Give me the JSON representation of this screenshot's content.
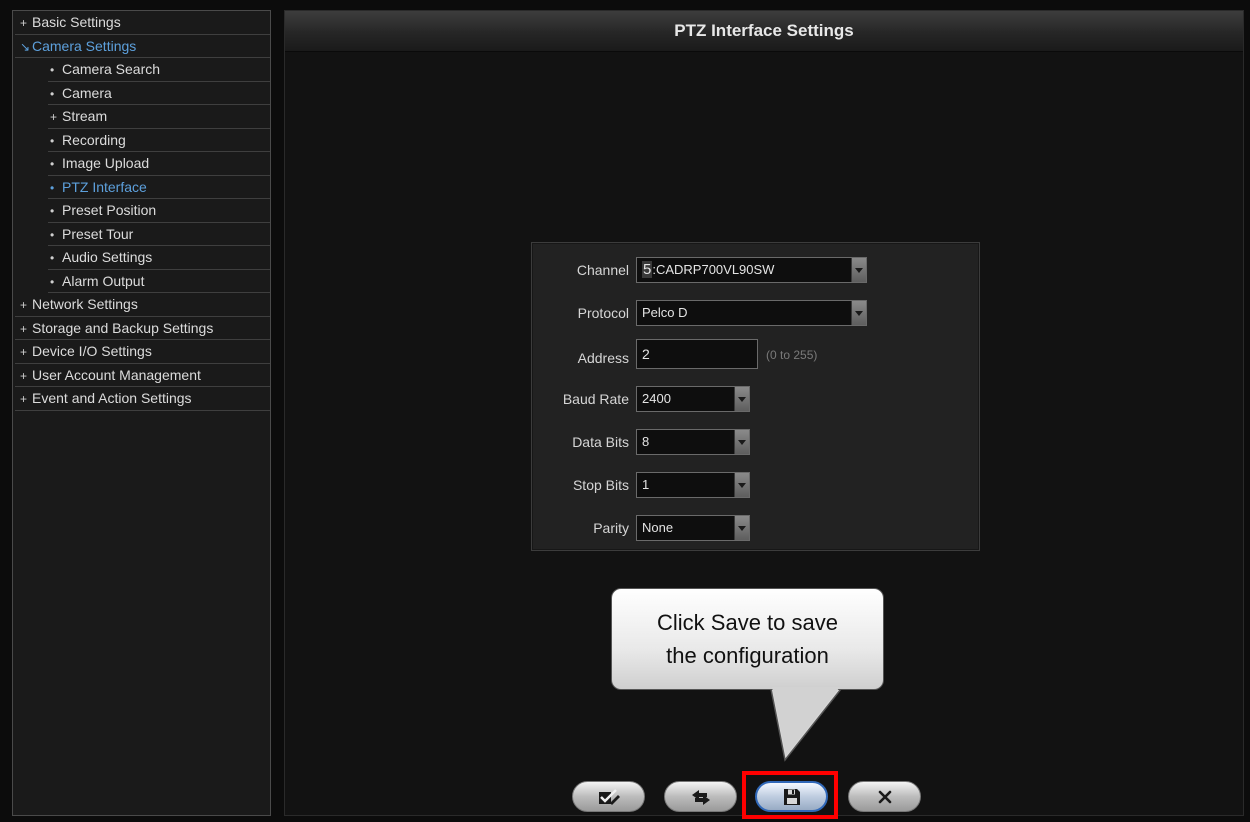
{
  "sidebar": {
    "items": [
      {
        "label": "Basic Settings",
        "marker": "+",
        "level": 1,
        "active": false
      },
      {
        "label": "Camera Settings",
        "marker": "↘",
        "level": 1,
        "active": true
      },
      {
        "label": "Camera Search",
        "marker": "•",
        "level": 2,
        "active": false
      },
      {
        "label": "Camera",
        "marker": "•",
        "level": 2,
        "active": false
      },
      {
        "label": "Stream",
        "marker": "+",
        "level": 2,
        "active": false
      },
      {
        "label": "Recording",
        "marker": "•",
        "level": 2,
        "active": false
      },
      {
        "label": "Image Upload",
        "marker": "•",
        "level": 2,
        "active": false
      },
      {
        "label": "PTZ Interface",
        "marker": "•",
        "level": 2,
        "active": true
      },
      {
        "label": "Preset Position",
        "marker": "•",
        "level": 2,
        "active": false
      },
      {
        "label": "Preset Tour",
        "marker": "•",
        "level": 2,
        "active": false
      },
      {
        "label": "Audio Settings",
        "marker": "•",
        "level": 2,
        "active": false
      },
      {
        "label": "Alarm Output",
        "marker": "•",
        "level": 2,
        "active": false
      },
      {
        "label": "Network Settings",
        "marker": "+",
        "level": 1,
        "active": false
      },
      {
        "label": "Storage and Backup Settings",
        "marker": "+",
        "level": 1,
        "active": false
      },
      {
        "label": "Device I/O Settings",
        "marker": "+",
        "level": 1,
        "active": false
      },
      {
        "label": "User Account Management",
        "marker": "+",
        "level": 1,
        "active": false
      },
      {
        "label": "Event and Action Settings",
        "marker": "+",
        "level": 1,
        "active": false
      }
    ]
  },
  "header": {
    "title": "PTZ Interface Settings"
  },
  "form": {
    "channel": {
      "label": "Channel",
      "number": "5",
      "value": ":CADRP700VL90SW"
    },
    "protocol": {
      "label": "Protocol",
      "value": "Pelco D"
    },
    "address": {
      "label": "Address",
      "value": "2",
      "hint": "(0 to 255)"
    },
    "baud_rate": {
      "label": "Baud Rate",
      "value": "2400"
    },
    "data_bits": {
      "label": "Data Bits",
      "value": "8"
    },
    "stop_bits": {
      "label": "Stop Bits",
      "value": "1"
    },
    "parity": {
      "label": "Parity",
      "value": "None"
    }
  },
  "callout": {
    "line1": "Click Save to save",
    "line2": "the configuration"
  },
  "buttons": {
    "apply_icon": "checkmark-pencil-icon",
    "refresh_icon": "refresh-arrows-icon",
    "save_icon": "floppy-disk-icon",
    "close_icon": "close-icon"
  },
  "colors": {
    "active": "#5da0dc",
    "highlight": "#ff0000",
    "save_border": "#3068b8"
  }
}
